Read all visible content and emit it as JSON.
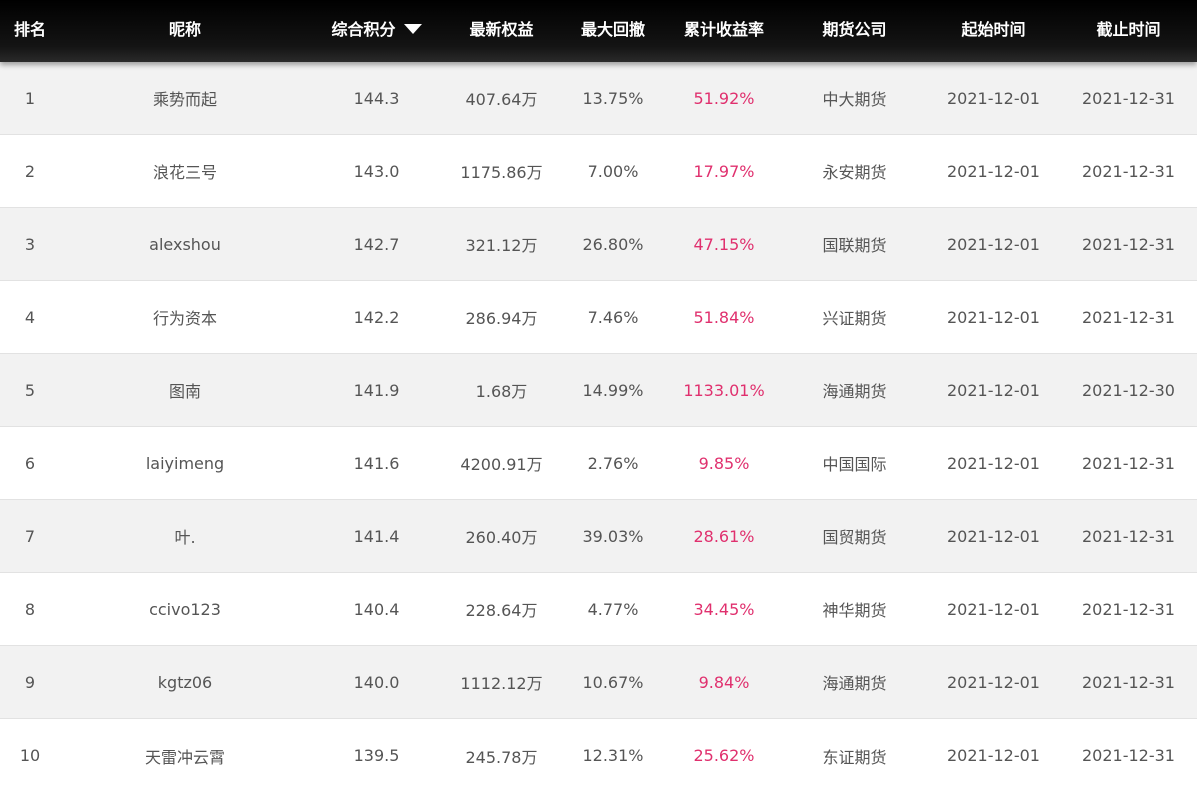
{
  "header": {
    "rank": "排名",
    "nickname": "昵称",
    "score": "综合积分",
    "equity": "最新权益",
    "drawdown": "最大回撤",
    "return": "累计收益率",
    "company": "期货公司",
    "start": "起始时间",
    "end": "截止时间",
    "sort_icon": "triangle-down-icon"
  },
  "colors": {
    "header_bg": "#111111",
    "row_alt": "#f2f2f2",
    "return_text": "#e0306e",
    "body_text": "#555555"
  },
  "rows": [
    {
      "rank": "1",
      "nickname": "乘势而起",
      "score": "144.3",
      "equity": "407.64万",
      "drawdown": "13.75%",
      "return": "51.92%",
      "company": "中大期货",
      "start": "2021-12-01",
      "end": "2021-12-31"
    },
    {
      "rank": "2",
      "nickname": "浪花三号",
      "score": "143.0",
      "equity": "1175.86万",
      "drawdown": "7.00%",
      "return": "17.97%",
      "company": "永安期货",
      "start": "2021-12-01",
      "end": "2021-12-31"
    },
    {
      "rank": "3",
      "nickname": "alexshou",
      "score": "142.7",
      "equity": "321.12万",
      "drawdown": "26.80%",
      "return": "47.15%",
      "company": "国联期货",
      "start": "2021-12-01",
      "end": "2021-12-31"
    },
    {
      "rank": "4",
      "nickname": "行为资本",
      "score": "142.2",
      "equity": "286.94万",
      "drawdown": "7.46%",
      "return": "51.84%",
      "company": "兴证期货",
      "start": "2021-12-01",
      "end": "2021-12-31"
    },
    {
      "rank": "5",
      "nickname": "图南",
      "score": "141.9",
      "equity": "1.68万",
      "drawdown": "14.99%",
      "return": "1133.01%",
      "company": "海通期货",
      "start": "2021-12-01",
      "end": "2021-12-30"
    },
    {
      "rank": "6",
      "nickname": "laiyimeng",
      "score": "141.6",
      "equity": "4200.91万",
      "drawdown": "2.76%",
      "return": "9.85%",
      "company": "中国国际",
      "start": "2021-12-01",
      "end": "2021-12-31"
    },
    {
      "rank": "7",
      "nickname": "叶.",
      "score": "141.4",
      "equity": "260.40万",
      "drawdown": "39.03%",
      "return": "28.61%",
      "company": "国贸期货",
      "start": "2021-12-01",
      "end": "2021-12-31"
    },
    {
      "rank": "8",
      "nickname": "ccivo123",
      "score": "140.4",
      "equity": "228.64万",
      "drawdown": "4.77%",
      "return": "34.45%",
      "company": "神华期货",
      "start": "2021-12-01",
      "end": "2021-12-31"
    },
    {
      "rank": "9",
      "nickname": "kgtz06",
      "score": "140.0",
      "equity": "1112.12万",
      "drawdown": "10.67%",
      "return": "9.84%",
      "company": "海通期货",
      "start": "2021-12-01",
      "end": "2021-12-31"
    },
    {
      "rank": "10",
      "nickname": "天雷冲云霄",
      "score": "139.5",
      "equity": "245.78万",
      "drawdown": "12.31%",
      "return": "25.62%",
      "company": "东证期货",
      "start": "2021-12-01",
      "end": "2021-12-31"
    }
  ]
}
